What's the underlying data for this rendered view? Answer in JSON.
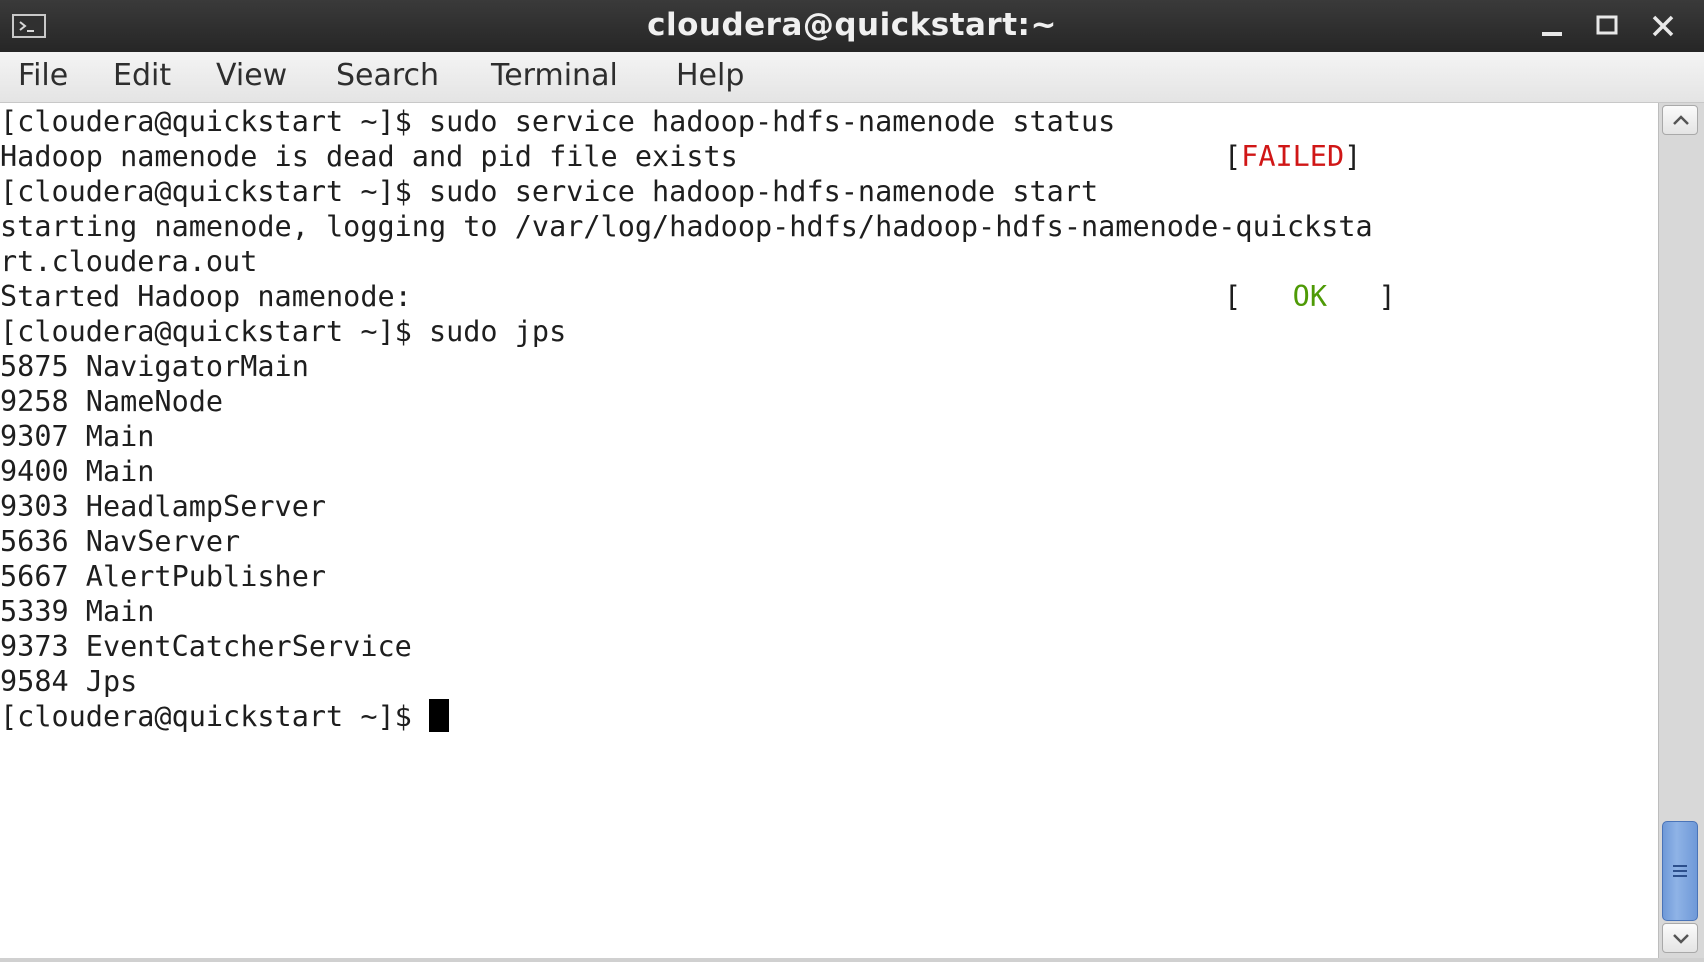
{
  "window": {
    "title": "cloudera@quickstart:~",
    "icon": "terminal-icon",
    "controls": [
      "minimize-icon",
      "maximize-icon",
      "close-icon"
    ]
  },
  "menu": {
    "file": "File",
    "edit": "Edit",
    "view": "View",
    "search": "Search",
    "terminal": "Terminal",
    "help": "Help"
  },
  "terminal": {
    "lines": [
      "[cloudera@quickstart ~]$ sudo service hadoop-hdfs-namenode status",
      "Hadoop namenode is dead and pid file exists",
      "[cloudera@quickstart ~]$ sudo service hadoop-hdfs-namenode start",
      "starting namenode, logging to /var/log/hadoop-hdfs/hadoop-hdfs-namenode-quicksta",
      "rt.cloudera.out",
      "Started Hadoop namenode:",
      "[cloudera@quickstart ~]$ sudo jps",
      "5875 NavigatorMain",
      "9258 NameNode",
      "9307 Main",
      "9400 Main",
      "9303 HeadlampServer",
      "5636 NavServer",
      "5667 AlertPublisher",
      "5339 Main",
      "9373 EventCatcherService",
      "9584 Jps",
      "[cloudera@quickstart ~]$ "
    ],
    "status_failed": {
      "open": "[",
      "text": "FAILED",
      "close": "]",
      "color": "#d01616"
    },
    "status_ok": {
      "open": "[",
      "text": "OK",
      "close": "]",
      "color": "#4e9a06"
    }
  },
  "colors": {
    "titlebar": "#2c2c2c",
    "menubar": "#ececec",
    "text": "#1e1e1e",
    "scroll_thumb": "#7aa3de"
  }
}
